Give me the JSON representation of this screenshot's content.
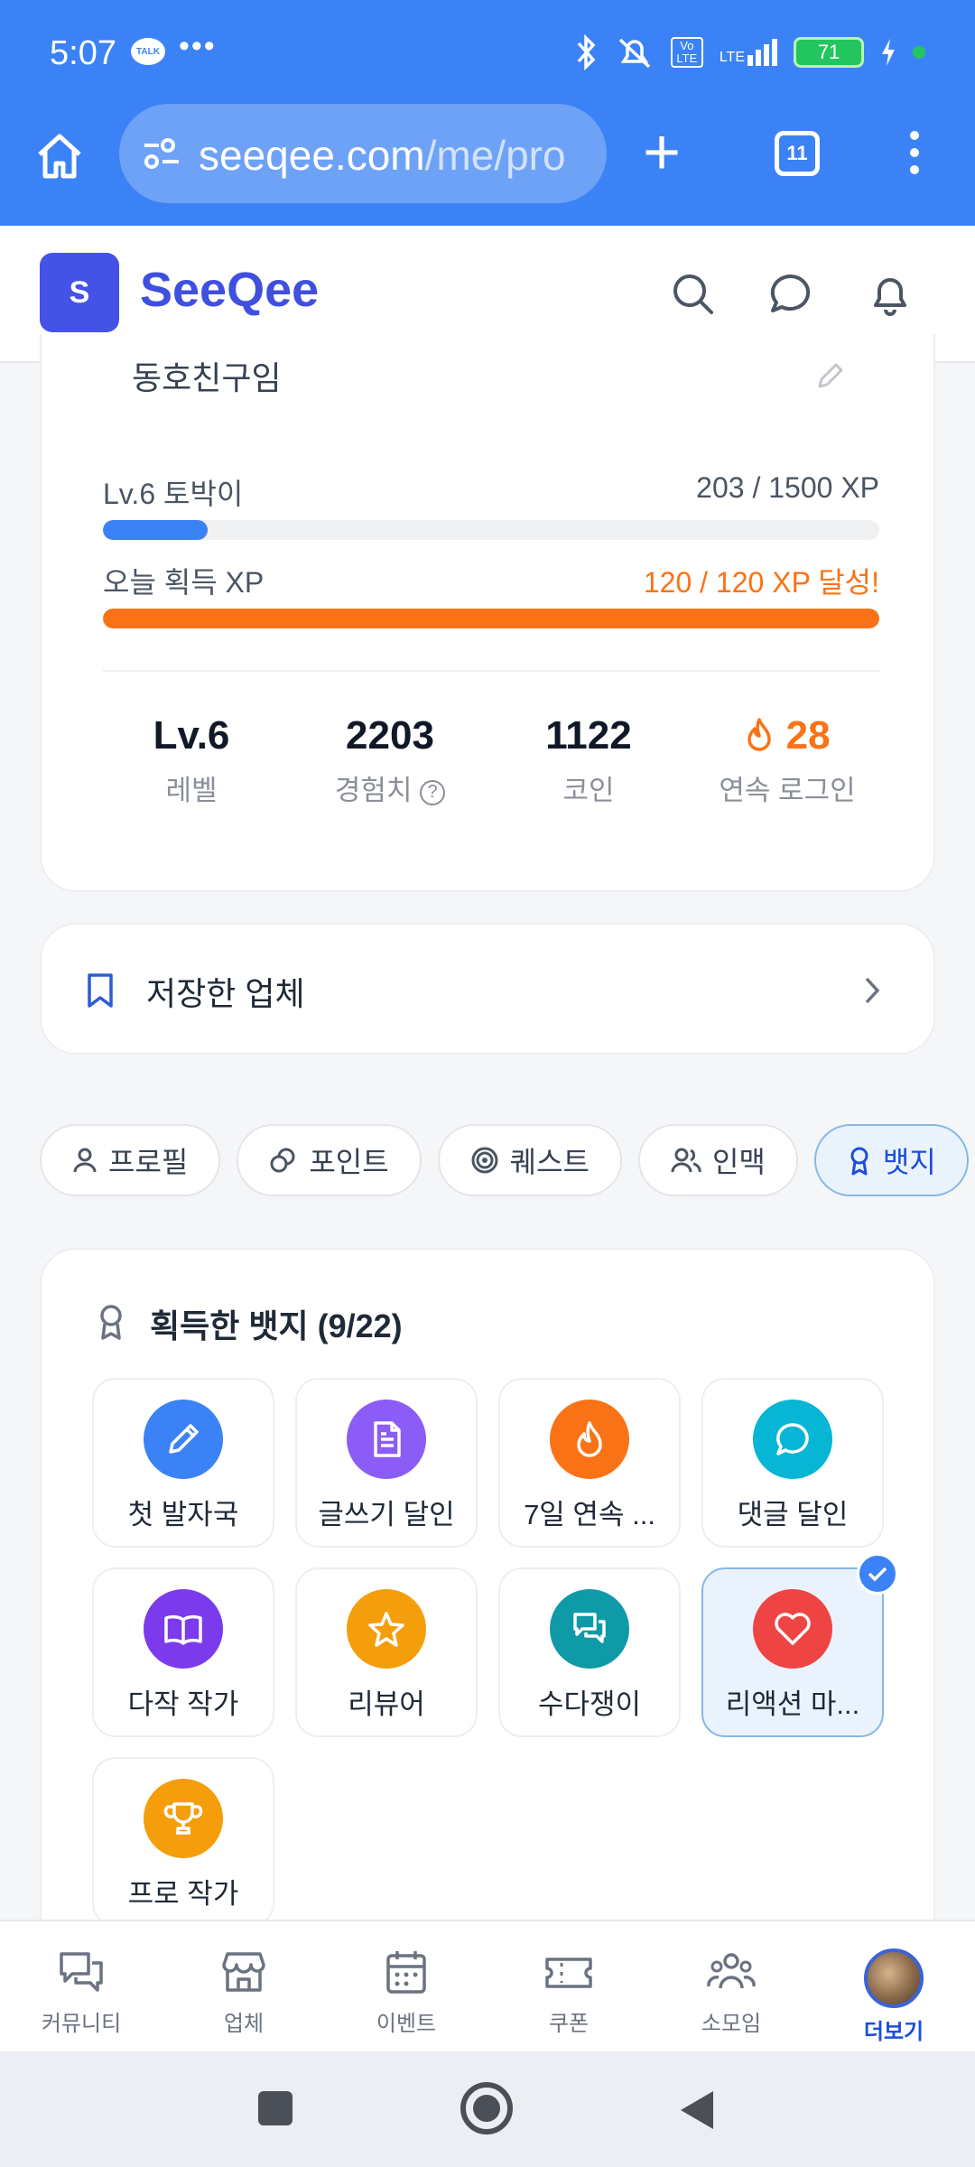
{
  "status": {
    "time": "5:07",
    "talk": "TALK",
    "dots": "•••",
    "lte": "LTE",
    "volte": "Vo LTE",
    "battery": "71"
  },
  "browser": {
    "url_host": "seeqee.com",
    "url_path": "/me/pro",
    "tab_count": "11"
  },
  "app": {
    "logo_letter": "S",
    "brand": "SeeQee"
  },
  "profile": {
    "nickname": "동호친구임",
    "level_label": "Lv.6 토박이",
    "level_xp": "203 / 1500 XP",
    "level_progress": 0.135,
    "today_label": "오늘 획득 XP",
    "today_xp": "120 / 120 XP 달성!",
    "today_progress": 1.0,
    "stats": [
      {
        "value": "Lv.6",
        "label": "레벨"
      },
      {
        "value": "2203",
        "label": "경험치"
      },
      {
        "value": "1122",
        "label": "코인"
      },
      {
        "value": "28",
        "label": "연속 로그인"
      }
    ],
    "help_mark": "?"
  },
  "saved": {
    "label": "저장한 업체"
  },
  "tabs": [
    "프로필",
    "포인트",
    "퀘스트",
    "인맥",
    "뱃지"
  ],
  "badges": {
    "title": "획득한 뱃지 (9/22)",
    "items": [
      {
        "name": "첫 발자국",
        "color": "#3b82f6",
        "icon": "pencil-icon"
      },
      {
        "name": "글쓰기 달인",
        "color": "#8b5cf6",
        "icon": "document-icon"
      },
      {
        "name": "7일 연속 ...",
        "color": "#f97316",
        "icon": "flame-icon"
      },
      {
        "name": "댓글 달인",
        "color": "#06b6d4",
        "icon": "chat-icon"
      },
      {
        "name": "다작 작가",
        "color": "#7c3aed",
        "icon": "book-icon"
      },
      {
        "name": "리뷰어",
        "color": "#f59e0b",
        "icon": "star-icon"
      },
      {
        "name": "수다쟁이",
        "color": "#0e9aa7",
        "icon": "chats-icon"
      },
      {
        "name": "리액션 마...",
        "color": "#ef4444",
        "icon": "heart-icon",
        "selected": true
      },
      {
        "name": "프로 작가",
        "color": "#f59e0b",
        "icon": "trophy-icon"
      }
    ]
  },
  "bottom_nav": [
    "커뮤니티",
    "업체",
    "이벤트",
    "쿠폰",
    "소모임",
    "더보기"
  ],
  "colors": {
    "primary": "#3b82f6",
    "brand": "#3f4fe0",
    "orange": "#f97316"
  }
}
